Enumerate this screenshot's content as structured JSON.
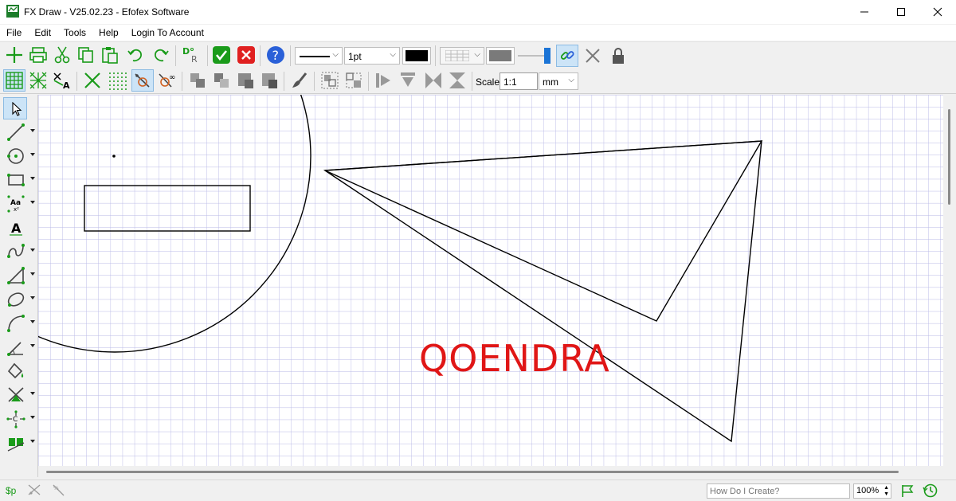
{
  "window": {
    "title": "FX Draw - V25.02.23 - Efofex Software",
    "app_icon_text": "FXD"
  },
  "menu": [
    "File",
    "Edit",
    "Tools",
    "Help",
    "Login To Account"
  ],
  "toolbar": {
    "line_width": "1pt",
    "scale_label": "Scale",
    "scale_value": "1:1",
    "units": "mm"
  },
  "canvas": {
    "label_text": "QOENDRA",
    "label_color": "#e01616",
    "grid_color": "#b8b8e6"
  },
  "status": {
    "dollar_p": "$p",
    "help_placeholder": "How Do I Create?",
    "zoom": "100%"
  },
  "colors": {
    "accent_green": "#1a9b1a",
    "accent_red": "#e02020",
    "accent_blue": "#2a60d8",
    "active_bg": "#cce4f7"
  }
}
